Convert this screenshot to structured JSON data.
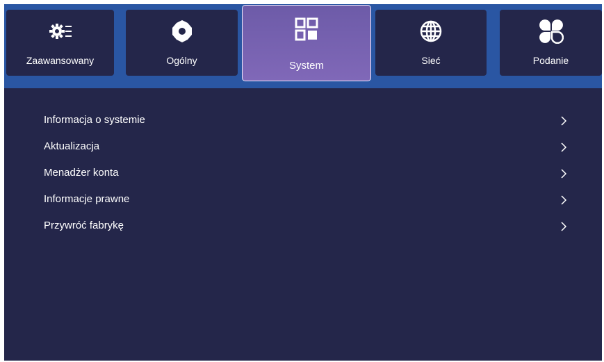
{
  "tabs": [
    {
      "label": "Zaawansowany",
      "icon": "advanced-settings-icon"
    },
    {
      "label": "Ogólny",
      "icon": "gear-icon"
    },
    {
      "label": "System",
      "icon": "system-windows-icon",
      "active": true
    },
    {
      "label": "Sieć",
      "icon": "globe-icon"
    },
    {
      "label": "Podanie",
      "icon": "apps-icon"
    }
  ],
  "menu": {
    "items": [
      {
        "label": "Informacja o systemie"
      },
      {
        "label": "Aktualizacja"
      },
      {
        "label": "Menadżer konta"
      },
      {
        "label": "Informacje prawne"
      },
      {
        "label": "Przywróć fabrykę"
      }
    ]
  },
  "colors": {
    "background": "#24264a",
    "topbar": "#2a56a3",
    "active_tab": "#7a64b2",
    "text": "#ffffff"
  }
}
